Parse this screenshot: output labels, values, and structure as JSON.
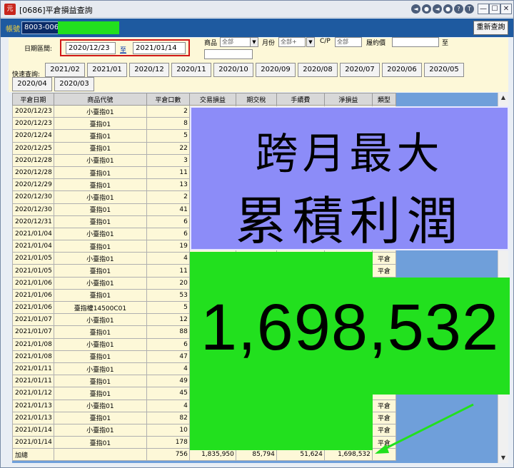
{
  "window": {
    "title": "[0686]平倉損益查詢",
    "app_icon_glyph": "元",
    "controls": [
      "◄",
      "●",
      "◄",
      "●",
      "?",
      "T"
    ],
    "minimize_glyph": "—",
    "maximize_glyph": "☐",
    "close_glyph": "✕"
  },
  "account": {
    "label": "帳號",
    "value": "8003-0066"
  },
  "toolbar": {
    "refresh_label": "重新查詢"
  },
  "filters": {
    "date_range_label": "日期區間:",
    "date_from": "2020/12/23",
    "to_label": "至",
    "date_to": "2021/01/14",
    "product_label": "商品",
    "product_value": "全部",
    "month_label": "月份",
    "month_value": "全部+",
    "cp_label": "C/P",
    "cp_value": "全部",
    "strike_label": "履約價",
    "strike_to_label": "至",
    "quick_query_label": "快速查詢:",
    "quick_buttons": [
      "2021/02",
      "2021/01",
      "2020/12",
      "2020/11",
      "2020/10",
      "2020/09",
      "2020/08",
      "2020/07",
      "2020/06",
      "2020/05",
      "2020/04",
      "2020/03"
    ]
  },
  "table": {
    "headers": [
      "平倉日期",
      "商品代號",
      "平倉口數",
      "交易損益",
      "期交稅",
      "手續費",
      "淨損益",
      "類型"
    ],
    "rows": [
      {
        "date": "2020/12/23",
        "product": "小臺指01",
        "qty": "2",
        "type": ""
      },
      {
        "date": "2020/12/23",
        "product": "臺指01",
        "qty": "8",
        "type": ""
      },
      {
        "date": "2020/12/24",
        "product": "臺指01",
        "qty": "5",
        "type": ""
      },
      {
        "date": "2020/12/25",
        "product": "臺指01",
        "qty": "22",
        "type": ""
      },
      {
        "date": "2020/12/28",
        "product": "小臺指01",
        "qty": "3",
        "type": ""
      },
      {
        "date": "2020/12/28",
        "product": "臺指01",
        "qty": "11",
        "type": ""
      },
      {
        "date": "2020/12/29",
        "product": "臺指01",
        "qty": "13",
        "type": ""
      },
      {
        "date": "2020/12/30",
        "product": "小臺指01",
        "qty": "2",
        "type": ""
      },
      {
        "date": "2020/12/30",
        "product": "臺指01",
        "qty": "41",
        "type": ""
      },
      {
        "date": "2020/12/31",
        "product": "臺指01",
        "qty": "6",
        "type": ""
      },
      {
        "date": "2021/01/04",
        "product": "小臺指01",
        "qty": "6",
        "type": ""
      },
      {
        "date": "2021/01/04",
        "product": "臺指01",
        "qty": "19",
        "type": ""
      },
      {
        "date": "2021/01/05",
        "product": "小臺指01",
        "qty": "4",
        "type": "平倉"
      },
      {
        "date": "2021/01/05",
        "product": "臺指01",
        "qty": "11",
        "type": "平倉"
      },
      {
        "date": "2021/01/06",
        "product": "小臺指01",
        "qty": "20",
        "type": ""
      },
      {
        "date": "2021/01/06",
        "product": "臺指01",
        "qty": "53",
        "type": ""
      },
      {
        "date": "2021/01/06",
        "product": "臺指權14500C01",
        "qty": "5",
        "type": ""
      },
      {
        "date": "2021/01/07",
        "product": "小臺指01",
        "qty": "12",
        "type": ""
      },
      {
        "date": "2021/01/07",
        "product": "臺指01",
        "qty": "88",
        "type": ""
      },
      {
        "date": "2021/01/08",
        "product": "小臺指01",
        "qty": "6",
        "type": ""
      },
      {
        "date": "2021/01/08",
        "product": "臺指01",
        "qty": "47",
        "type": ""
      },
      {
        "date": "2021/01/11",
        "product": "小臺指01",
        "qty": "4",
        "type": ""
      },
      {
        "date": "2021/01/11",
        "product": "臺指01",
        "qty": "49",
        "type": ""
      },
      {
        "date": "2021/01/12",
        "product": "臺指01",
        "qty": "45",
        "type": ""
      },
      {
        "date": "2021/01/13",
        "product": "小臺指01",
        "qty": "4",
        "type": "平倉"
      },
      {
        "date": "2021/01/13",
        "product": "臺指01",
        "qty": "82",
        "type": "平倉"
      },
      {
        "date": "2021/01/14",
        "product": "小臺指01",
        "qty": "10",
        "type": "平倉"
      },
      {
        "date": "2021/01/14",
        "product": "臺指01",
        "qty": "178",
        "type": "平倉"
      }
    ],
    "total": {
      "label": "加總",
      "qty": "756",
      "trade_pnl": "1,835,950",
      "tax": "85,794",
      "fee": "51,624",
      "net_pnl": "1,698,532"
    }
  },
  "overlay": {
    "headline_line1": "跨月最大",
    "headline_line2": "累積利潤",
    "amount": "1,698,532"
  },
  "colors": {
    "highlight_green": "#22e01e",
    "callout_purple": "#8c8cf8",
    "date_box_red": "#d01818",
    "account_bar_blue": "#1e5aa0"
  },
  "icons": {
    "scroll_up": "up-arrow-icon",
    "scroll_down": "down-arrow-icon"
  }
}
